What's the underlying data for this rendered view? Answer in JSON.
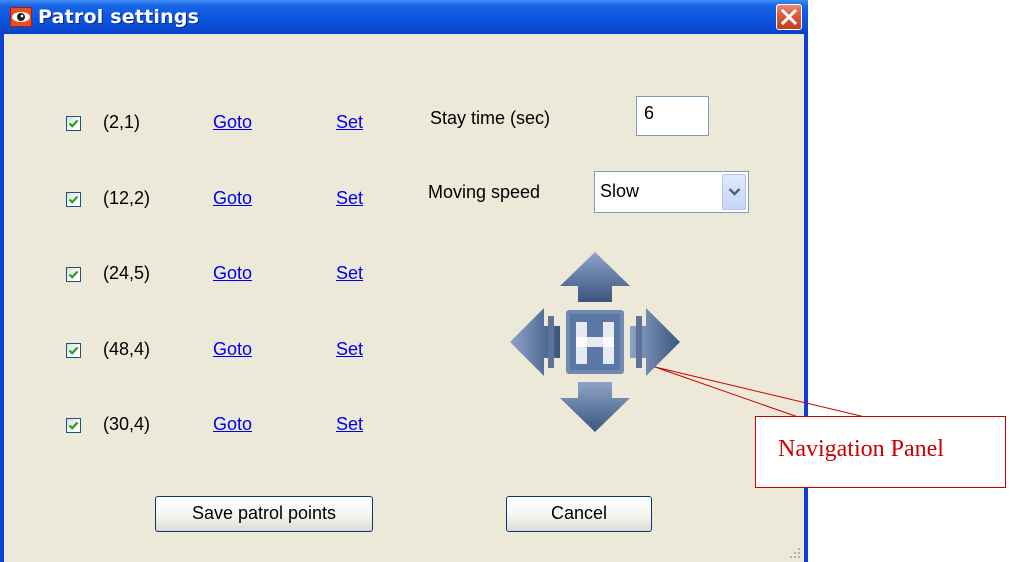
{
  "window": {
    "title": "Patrol settings",
    "close_icon": "close-x-icon",
    "app_icon": "eye-icon",
    "colors": {
      "titlebar": "#0c55e0",
      "client": "#ece9d8",
      "close": "#d85a3a",
      "link": "#0000ee"
    }
  },
  "patrol_points": [
    {
      "label": "(2,1)",
      "checked": true,
      "goto": "Goto",
      "set": "Set"
    },
    {
      "label": "(12,2)",
      "checked": true,
      "goto": "Goto",
      "set": "Set"
    },
    {
      "label": "(24,5)",
      "checked": true,
      "goto": "Goto",
      "set": "Set"
    },
    {
      "label": "(48,4)",
      "checked": true,
      "goto": "Goto",
      "set": "Set"
    },
    {
      "label": "(30,4)",
      "checked": true,
      "goto": "Goto",
      "set": "Set"
    }
  ],
  "stay_time": {
    "label": "Stay time (sec)",
    "value": "6"
  },
  "moving_speed": {
    "label": "Moving speed",
    "value": "Slow"
  },
  "nav_panel": {
    "center_label": "H",
    "icons": [
      "arrow-up-icon",
      "arrow-left-icon",
      "home-icon",
      "arrow-right-icon",
      "arrow-down-icon"
    ]
  },
  "buttons": {
    "save": "Save patrol points",
    "cancel": "Cancel"
  },
  "annotation": {
    "text": "Navigation Panel",
    "color": "#cc0000"
  }
}
